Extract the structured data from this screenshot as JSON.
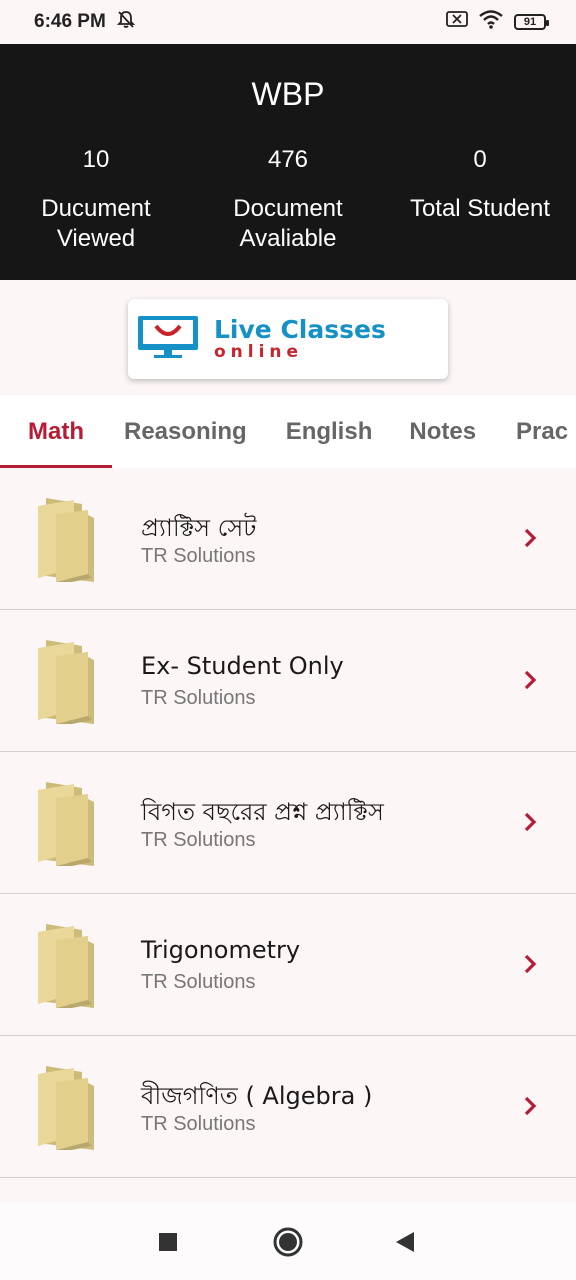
{
  "status_bar": {
    "time": "6:46 PM",
    "battery": "91",
    "icons": [
      "bell-off-icon",
      "sim-x-icon",
      "wifi-icon",
      "battery-icon"
    ]
  },
  "header": {
    "title": "WBP",
    "stats": [
      {
        "value": "10",
        "label": "Ducument\nViewed"
      },
      {
        "value": "476",
        "label": "Document\nAvaliable"
      },
      {
        "value": "0",
        "label": "Total Student"
      }
    ]
  },
  "banner": {
    "main": "Live Classes",
    "sub": "online",
    "icon": "monitor-smile-icon"
  },
  "tabs": [
    {
      "label": "Math",
      "active": true
    },
    {
      "label": "Reasoning",
      "active": false
    },
    {
      "label": "English",
      "active": false
    },
    {
      "label": "Notes",
      "active": false
    },
    {
      "label": "Prac",
      "active": false
    }
  ],
  "items": [
    {
      "title": "প্র্যাক্টিস সেট",
      "subtitle": "TR Solutions"
    },
    {
      "title": "Ex- Student Only",
      "subtitle": "TR Solutions"
    },
    {
      "title": "বিগত বছরের প্রশ্ন প্র্যাক্টিস",
      "subtitle": "TR Solutions"
    },
    {
      "title": "Trigonometry",
      "subtitle": "TR Solutions"
    },
    {
      "title": "বীজগণিত ( Algebra )",
      "subtitle": "TR Solutions"
    }
  ],
  "colors": {
    "accent": "#b81c35",
    "header_bg": "#161616",
    "page_bg": "#fdf6f6",
    "folder": "#e8d48e"
  },
  "nav_icons": [
    "recents-square-icon",
    "home-circle-icon",
    "back-triangle-icon"
  ]
}
